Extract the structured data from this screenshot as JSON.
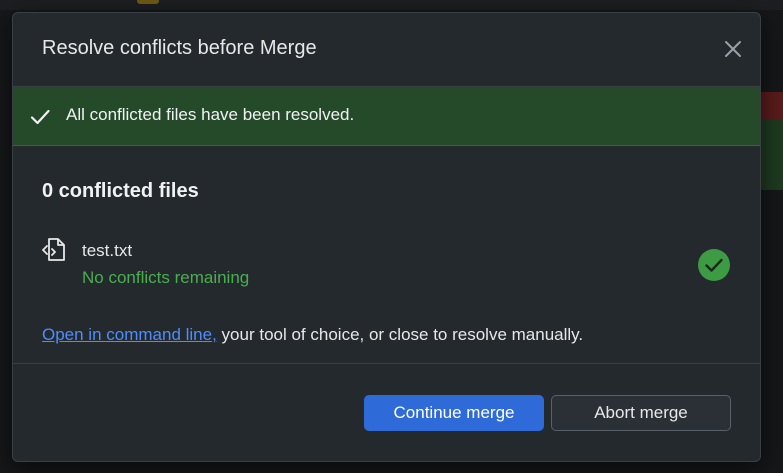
{
  "dialog": {
    "title": "Resolve conflicts before Merge",
    "close_icon": "close-icon"
  },
  "banner": {
    "icon": "checkmark-icon",
    "message": "All conflicted files have been resolved."
  },
  "conflicts": {
    "count_label": "0 conflicted files",
    "files": [
      {
        "icon": "code-file-icon",
        "name": "test.txt",
        "status": "No conflicts remaining",
        "status_icon": "resolved-check-icon"
      }
    ]
  },
  "hint": {
    "link_text": "Open in command line,",
    "rest_text": " your tool of choice, or close to resolve manually."
  },
  "footer": {
    "continue_label": "Continue merge",
    "abort_label": "Abort merge"
  },
  "colors": {
    "banner_bg": "#254a2a",
    "success_green": "#4aae4f",
    "link_blue": "#4c8dff",
    "primary_button": "#2f6bd8",
    "dialog_bg": "#24292e"
  }
}
